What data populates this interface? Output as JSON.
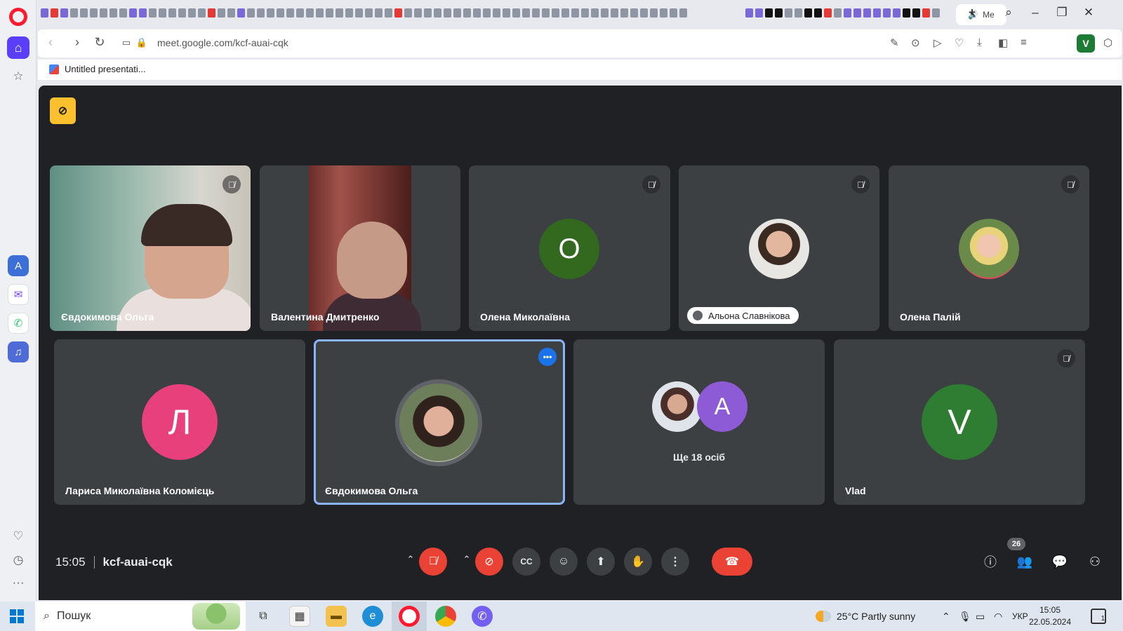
{
  "browser": {
    "url": "meet.google.com/kcf-auai-cqk",
    "active_tab_label": "Me",
    "bookmark_label": "Untitled presentati...",
    "profile_letter": "V"
  },
  "meet": {
    "tiles_row1": [
      {
        "name": "Євдокимова Ольга",
        "type": "video1",
        "muted": true
      },
      {
        "name": "Валентина Дмитренко",
        "type": "video2",
        "muted": false
      },
      {
        "name": "Олена Миколаївна",
        "type": "letter",
        "letter": "О",
        "color": "#33691e",
        "muted": true
      },
      {
        "name": "Альона Славнікова",
        "type": "photo",
        "muted": true,
        "hand_raised": true
      },
      {
        "name": "Олена Палій",
        "type": "photo",
        "muted": true
      }
    ],
    "tiles_row2": [
      {
        "name": "Лариса Миколаївна Коломієць",
        "type": "letter",
        "letter": "Л",
        "color": "#e8407a",
        "muted": false
      },
      {
        "name": "Євдокимова Ольга",
        "type": "photo-self",
        "muted": false,
        "selected": true
      },
      {
        "name": "",
        "type": "others",
        "others_text": "Ще 18 осіб",
        "letter": "А",
        "color": "#8e5bd6"
      },
      {
        "name": "Vlad",
        "type": "letter",
        "letter": "V",
        "color": "#2e7d32",
        "muted": true
      }
    ],
    "time": "15:05",
    "meeting_code": "kcf-auai-cqk",
    "participants_count": "26"
  },
  "taskbar": {
    "search_placeholder": "Пошук",
    "weather": "25°C  Partly sunny",
    "lang": "УКР",
    "time": "15:05",
    "date": "22.05.2024",
    "notifications": "1"
  }
}
